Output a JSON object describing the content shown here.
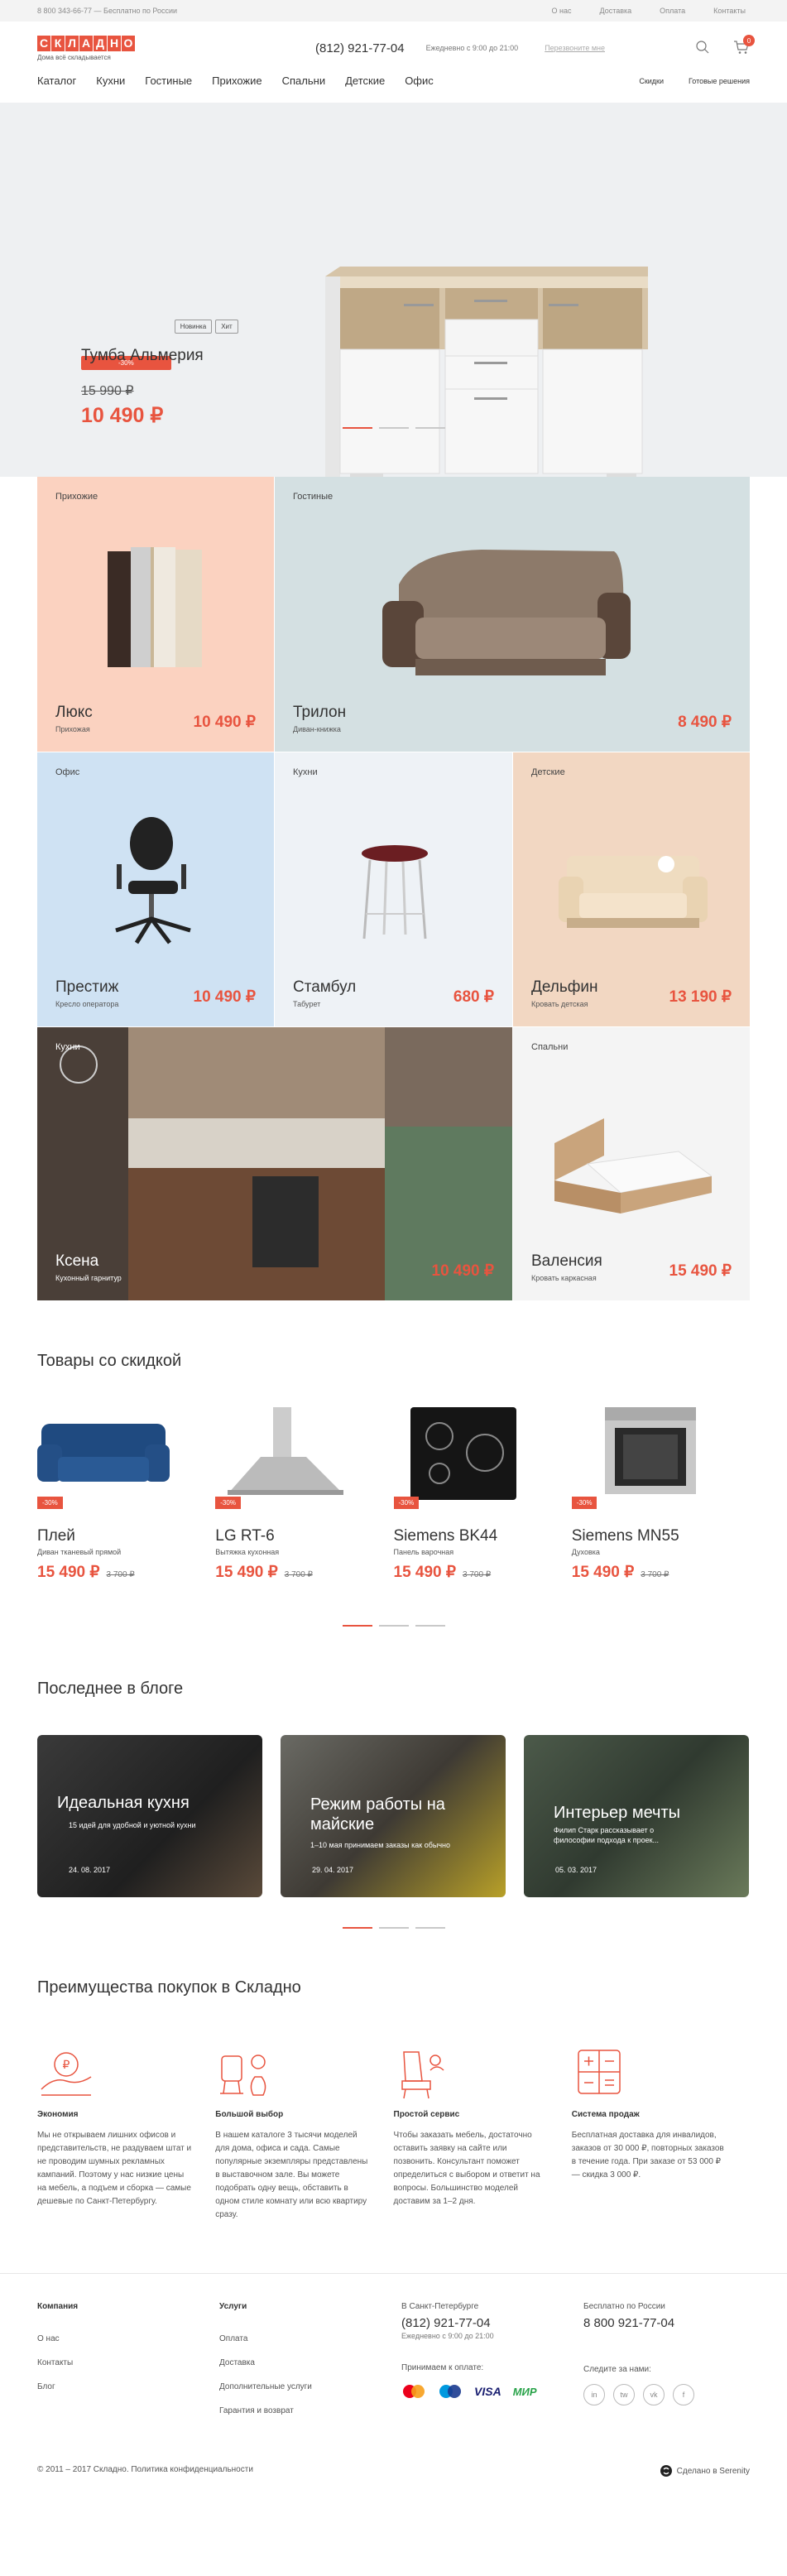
{
  "topbar": {
    "phone_line": "8 800 343-66-77 — Бесплатно по России",
    "links": [
      "О нас",
      "Доставка",
      "Оплата",
      "Контакты"
    ]
  },
  "header": {
    "logo_letters": [
      "С",
      "К",
      "Л",
      "А",
      "Д",
      "Н",
      "О"
    ],
    "tagline": "Дома всё складывается",
    "phone": "(812) 921-77-04",
    "hours": "Ежедневно с 9:00 до 21:00",
    "callback": "Перезвоните мне",
    "cart_count": "0"
  },
  "nav": {
    "main": [
      "Каталог",
      "Кухни",
      "Гостиные",
      "Прихожие",
      "Спальни",
      "Детские",
      "Офис"
    ],
    "right": [
      "Скидки",
      "Готовые решения"
    ]
  },
  "hero": {
    "badges": [
      "-30%",
      "Новинка",
      "Хит"
    ],
    "title": "Тумба Альмерия",
    "old_price": "15 990 ₽",
    "price": "10 490 ₽"
  },
  "categories": [
    {
      "cat": "Прихожие",
      "name": "Люкс",
      "sub": "Прихожая",
      "price": "10 490 ₽"
    },
    {
      "cat": "Гостиные",
      "name": "Трилон",
      "sub": "Диван-книжка",
      "price": "8 490 ₽"
    },
    {
      "cat": "Офис",
      "name": "Престиж",
      "sub": "Кресло оператора",
      "price": "10 490 ₽"
    },
    {
      "cat": "Кухни",
      "name": "Стамбул",
      "sub": "Табурет",
      "price": "680 ₽"
    },
    {
      "cat": "Детские",
      "name": "Дельфин",
      "sub": "Кровать детская",
      "price": "13 190 ₽"
    },
    {
      "cat": "Кухни",
      "name": "Ксена",
      "sub": "Кухонный гарнитур",
      "price": "10 490 ₽"
    },
    {
      "cat": "Спальни",
      "name": "Валенсия",
      "sub": "Кровать каркасная",
      "price": "15 490 ₽"
    }
  ],
  "sale_section": {
    "title": "Товары со скидкой",
    "items": [
      {
        "tag": "-30%",
        "name": "Плей",
        "sub": "Диван тканевый прямой",
        "price": "15 490 ₽",
        "old": "3 700 ₽"
      },
      {
        "tag": "-30%",
        "name": "LG RT-6",
        "sub": "Вытяжка кухонная",
        "price": "15 490 ₽",
        "old": "3 700 ₽"
      },
      {
        "tag": "-30%",
        "name": "Siemens BK44",
        "sub": "Панель варочная",
        "price": "15 490 ₽",
        "old": "3 700 ₽"
      },
      {
        "tag": "-30%",
        "name": "Siemens MN55",
        "sub": "Духовка",
        "price": "15 490 ₽",
        "old": "3 700 ₽"
      }
    ]
  },
  "blog_section": {
    "title": "Последнее в блоге",
    "posts": [
      {
        "title": "Идеальная кухня",
        "desc": "15 идей для удобной и уютной кухни",
        "date": "24. 08. 2017"
      },
      {
        "title": "Режим работы на майские",
        "desc": "1–10 мая принимаем заказы как обычно",
        "date": "29. 04. 2017"
      },
      {
        "title": "Интерьер мечты",
        "desc": "Филип Старк рассказывает о философии подхода к проек...",
        "date": "05. 03. 2017"
      }
    ]
  },
  "advantages_section": {
    "title": "Преимущества покупок в Складно",
    "items": [
      {
        "icon": "piggy-bank-icon",
        "title": "Экономия",
        "text": "Мы не открываем лишних офисов и представительств, не раздуваем штат и не проводим шумных рекламных кампаний. Поэтому у нас низкие цены на мебель, а подъем и сборка — самые дешевые по Санкт-Петербургу."
      },
      {
        "icon": "showroom-icon",
        "title": "Большой выбор",
        "text": "В нашем каталоге 3 тысячи моделей для дома, офиса и сада. Самые популярные экземпляры представлены в выставочном зале. Вы можете подобрать одну вещь, обставить в одном стиле комнату или всю квартиру сразу."
      },
      {
        "icon": "armchair-icon",
        "title": "Простой сервис",
        "text": "Чтобы заказать мебель, достаточно оставить заявку на сайте или позвонить. Консультант поможет определиться с выбором и ответит на вопросы. Большинство моделей доставим за 1–2 дня."
      },
      {
        "icon": "calculator-icon",
        "title": "Система продаж",
        "text": "Бесплатная доставка для инвалидов, заказов от 30 000 ₽, повторных заказов в течение года. При заказе от 53 000 ₽ — скидка 3 000 ₽."
      }
    ]
  },
  "footer": {
    "company_title": "Компания",
    "company_links": [
      "О нас",
      "Контакты",
      "Блог"
    ],
    "services_title": "Услуги",
    "services_links": [
      "Оплата",
      "Доставка",
      "Дополнительные услуги",
      "Гарантия и возврат"
    ],
    "spb_title": "В Санкт-Петербурге",
    "spb_phone": "(812) 921-77-04",
    "spb_hours": "Ежедневно с 9:00 до 21:00",
    "russia_title": "Бесплатно по России",
    "russia_phone": "8 800 921-77-04",
    "payments_label": "Принимаем к оплате:",
    "payments": [
      "Mastercard",
      "Maestro",
      "VISA",
      "МИР"
    ],
    "social_label": "Следите за нами:",
    "social": [
      "in",
      "tw",
      "vk",
      "f"
    ],
    "copyright": "© 2011 – 2017 Складно. Политика конфиденциальности",
    "made_by": "Сделано в Serenity"
  },
  "colors": {
    "accent": "#e8543f"
  }
}
